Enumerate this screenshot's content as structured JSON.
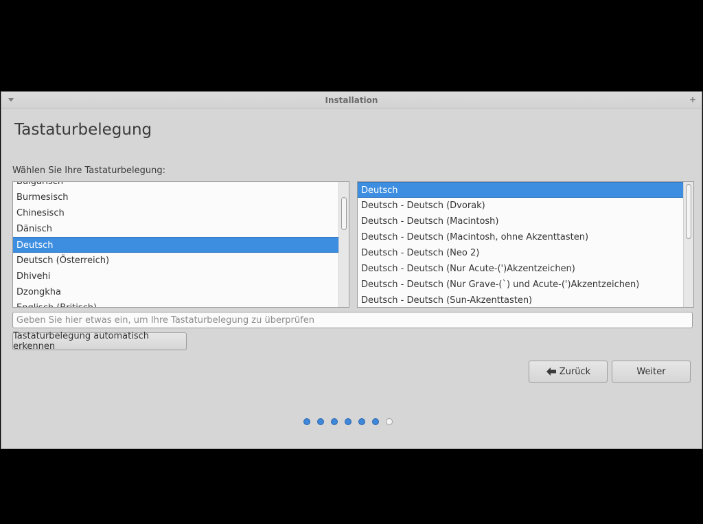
{
  "window": {
    "title": "Installation"
  },
  "page": {
    "title": "Tastaturbelegung",
    "prompt": "Wählen Sie Ihre Tastaturbelegung:"
  },
  "layouts": {
    "items": [
      {
        "label": "Bulgarisch",
        "selected": false
      },
      {
        "label": "Burmesisch",
        "selected": false
      },
      {
        "label": "Chinesisch",
        "selected": false
      },
      {
        "label": "Dänisch",
        "selected": false
      },
      {
        "label": "Deutsch",
        "selected": true
      },
      {
        "label": "Deutsch (Österreich)",
        "selected": false
      },
      {
        "label": "Dhivehi",
        "selected": false
      },
      {
        "label": "Dzongkha",
        "selected": false
      },
      {
        "label": "Englisch (Britisch)",
        "selected": false
      }
    ]
  },
  "variants": {
    "items": [
      {
        "label": "Deutsch",
        "selected": true
      },
      {
        "label": "Deutsch - Deutsch (Dvorak)",
        "selected": false
      },
      {
        "label": "Deutsch - Deutsch (Macintosh)",
        "selected": false
      },
      {
        "label": "Deutsch - Deutsch (Macintosh, ohne Akzenttasten)",
        "selected": false
      },
      {
        "label": "Deutsch - Deutsch (Neo 2)",
        "selected": false
      },
      {
        "label": "Deutsch - Deutsch (Nur Acute-(')Akzentzeichen)",
        "selected": false
      },
      {
        "label": "Deutsch - Deutsch (Nur Grave-(`) und Acute-(')Akzentzeichen)",
        "selected": false
      },
      {
        "label": "Deutsch - Deutsch (Sun-Akzenttasten)",
        "selected": false
      }
    ]
  },
  "test_field": {
    "placeholder": "Geben Sie hier etwas ein, um Ihre Tastaturbelegung zu überprüfen",
    "value": ""
  },
  "buttons": {
    "detect": "Tastaturbelegung automatisch erkennen",
    "back": "Zurück",
    "next": "Weiter"
  },
  "progress": {
    "total_steps": 7,
    "completed_steps": 6
  },
  "colors": {
    "selection": "#3d8ee0",
    "progress_dot": "#3f87d8"
  }
}
